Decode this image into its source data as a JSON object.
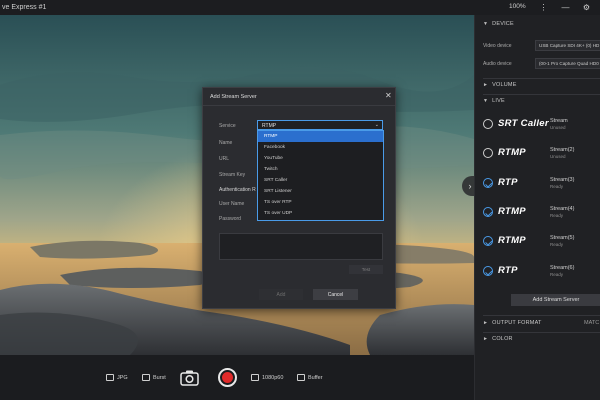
{
  "window": {
    "title": "ve Express #1",
    "zoom": "100%",
    "icons": [
      "more-icon",
      "minimize-icon",
      "settings-icon"
    ]
  },
  "panel": {
    "device": {
      "header": "DEVICE",
      "video_label": "Video device",
      "video_value": "USB Capture SDI 4K+ (0) HD",
      "audio_label": "Audio device",
      "audio_value": "(00-1 Pro Capture Quad HD0"
    },
    "volume": {
      "header": "VOLUME"
    },
    "live": {
      "header": "LIVE",
      "streams": [
        {
          "protocol": "SRT Caller",
          "name": "Stream",
          "status": "Unused",
          "icon": "circle-icon",
          "active": false
        },
        {
          "protocol": "RTMP",
          "name": "Stream(2)",
          "status": "Unused",
          "icon": "circle-icon",
          "active": false
        },
        {
          "protocol": "RTP",
          "name": "Stream(3)",
          "status": "Ready",
          "icon": "check-circle-icon",
          "active": true
        },
        {
          "protocol": "RTMP",
          "name": "Stream(4)",
          "status": "Ready",
          "icon": "check-circle-icon",
          "active": true
        },
        {
          "protocol": "RTMP",
          "name": "Stream(5)",
          "status": "Ready",
          "icon": "check-circle-icon",
          "active": true
        },
        {
          "protocol": "RTP",
          "name": "Stream(6)",
          "status": "Ready",
          "icon": "check-circle-icon",
          "active": true
        }
      ],
      "add_button": "Add Stream Server"
    },
    "output_format": {
      "header": "OUTPUT FORMAT",
      "value": "MATC"
    },
    "color": {
      "header": "COLOR"
    }
  },
  "bottombar": {
    "jpg_label": "JPG",
    "burst_label": "Burst",
    "resolution_label": "1080p60",
    "buffer_label": "Buffer"
  },
  "modal": {
    "title": "Add Stream Server",
    "labels": {
      "service": "Service",
      "name": "Name",
      "url": "URL",
      "stream_key": "Stream Key",
      "auth": "Authentication R",
      "user_name": "User Name",
      "password": "Password"
    },
    "service_value": "RTMP",
    "options": [
      "RTMP",
      "Facebook",
      "YouTube",
      "Twitch",
      "SRT Caller",
      "SRT Listener",
      "TS over RTP",
      "TS over UDP"
    ],
    "test_button": "Test",
    "add_button": "Add",
    "cancel_button": "Cancel"
  }
}
